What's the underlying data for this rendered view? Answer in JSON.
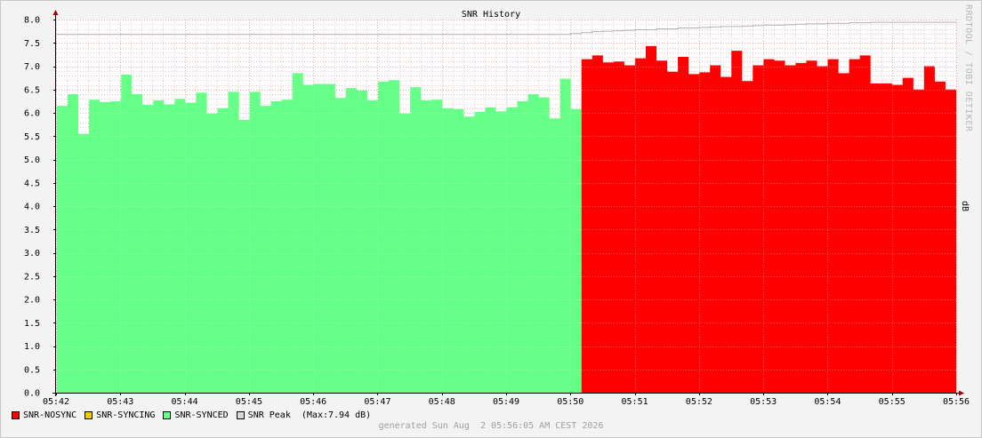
{
  "chart_data": {
    "type": "area",
    "title": "SNR History",
    "ylabel": "dB",
    "ylim": [
      0,
      8
    ],
    "y_ticks": [
      "0.0",
      "0.5",
      "1.0",
      "1.5",
      "2.0",
      "2.5",
      "3.0",
      "3.5",
      "4.0",
      "4.5",
      "5.0",
      "5.5",
      "6.0",
      "6.5",
      "7.0",
      "7.5",
      "8.0"
    ],
    "x_ticks": [
      "05:42",
      "05:43",
      "05:44",
      "05:45",
      "05:46",
      "05:47",
      "05:48",
      "05:49",
      "05:50",
      "05:51",
      "05:52",
      "05:53",
      "05:54",
      "05:55",
      "05:56"
    ],
    "grid": true,
    "series": [
      {
        "name": "SNR-SYNCED",
        "color": "#66ff88",
        "values": [
          6.15,
          6.4,
          5.55,
          6.28,
          6.23,
          6.25,
          6.82,
          6.4,
          6.17,
          6.27,
          6.18,
          6.3,
          6.22,
          6.43,
          5.98,
          6.1,
          6.45,
          5.85,
          6.45,
          6.15,
          6.25,
          6.28,
          6.85,
          6.6,
          6.62,
          6.62,
          6.32,
          6.53,
          6.48,
          6.27,
          6.67,
          6.7,
          5.98,
          6.55,
          6.27,
          6.28,
          6.1,
          6.08,
          5.92,
          6.02,
          6.12,
          6.03,
          6.12,
          6.25,
          6.4,
          6.33,
          5.88,
          6.73,
          6.08
        ]
      },
      {
        "name": "SNR-NOSYNC",
        "color": "#ff0000",
        "values": [
          7.15,
          7.23,
          7.08,
          7.1,
          7.02,
          7.17,
          7.43,
          7.12,
          6.88,
          7.2,
          6.83,
          6.87,
          7.02,
          6.77,
          7.33,
          6.68,
          7.02,
          7.15,
          7.12,
          7.02,
          7.07,
          7.12,
          7.0,
          7.15,
          6.85,
          7.15,
          7.23,
          6.63,
          6.63,
          6.6,
          6.75,
          6.5,
          7.0,
          6.67,
          6.5
        ]
      },
      {
        "name": "SNR-SYNCING",
        "color": "#eecc00",
        "values": []
      },
      {
        "name": "SNR Peak",
        "color": "#b0b0b0",
        "values": [
          7.68,
          7.68,
          7.68,
          7.68,
          7.68,
          7.68,
          7.68,
          7.68,
          7.68,
          7.68,
          7.68,
          7.68,
          7.68,
          7.68,
          7.68,
          7.68,
          7.68,
          7.68,
          7.68,
          7.68,
          7.68,
          7.68,
          7.68,
          7.68,
          7.68,
          7.68,
          7.68,
          7.68,
          7.68,
          7.68,
          7.68,
          7.68,
          7.68,
          7.68,
          7.68,
          7.68,
          7.68,
          7.68,
          7.68,
          7.68,
          7.68,
          7.68,
          7.68,
          7.68,
          7.68,
          7.68,
          7.68,
          7.68,
          7.7,
          7.72,
          7.74,
          7.75,
          7.76,
          7.77,
          7.78,
          7.78,
          7.8,
          7.8,
          7.82,
          7.82,
          7.83,
          7.84,
          7.85,
          7.85,
          7.86,
          7.87,
          7.88,
          7.88,
          7.89,
          7.9,
          7.91,
          7.91,
          7.92,
          7.92,
          7.93,
          7.93,
          7.94,
          7.94,
          7.94,
          7.94,
          7.94,
          7.94,
          7.94,
          7.94
        ]
      }
    ]
  },
  "legend": [
    {
      "label": "SNR-NOSYNC",
      "color": "#ff0000"
    },
    {
      "label": "SNR-SYNCING",
      "color": "#eecc00"
    },
    {
      "label": "SNR-SYNCED",
      "color": "#66ff88"
    },
    {
      "label": "SNR Peak  (Max:7.94 dB)",
      "color": "#d8d8d8"
    }
  ],
  "watermark": "RRDTOOL / TOBI OETIKER",
  "generated": "generated Sun Aug  2 05:56:05 AM CEST 2026"
}
